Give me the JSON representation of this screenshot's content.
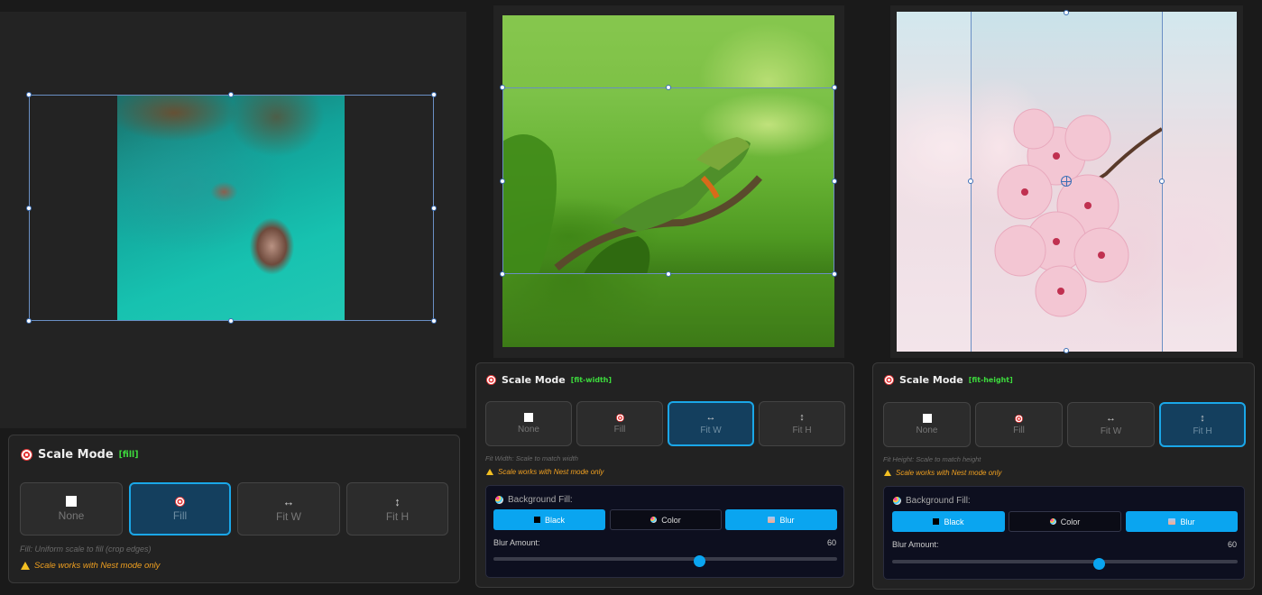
{
  "panels": [
    {
      "title": "Scale Mode",
      "mode_tag": "[fill]",
      "buttons": [
        {
          "label": "None",
          "icon": "square-icon"
        },
        {
          "label": "Fill",
          "icon": "target-icon"
        },
        {
          "label": "Fit W",
          "icon": "horizontal-arrows-icon",
          "glyph": "↔"
        },
        {
          "label": "Fit H",
          "icon": "vertical-arrows-icon",
          "glyph": "↕"
        }
      ],
      "active": "Fill",
      "hint": "Fill: Uniform scale to fill (crop edges)",
      "warning": "Scale works with Nest mode only"
    },
    {
      "title": "Scale Mode",
      "mode_tag": "[fit-width]",
      "buttons": [
        {
          "label": "None",
          "icon": "square-icon"
        },
        {
          "label": "Fill",
          "icon": "target-icon"
        },
        {
          "label": "Fit W",
          "icon": "horizontal-arrows-icon",
          "glyph": "↔"
        },
        {
          "label": "Fit H",
          "icon": "vertical-arrows-icon",
          "glyph": "↕"
        }
      ],
      "active": "Fit W",
      "hint": "Fit Width: Scale to match width",
      "warning": "Scale works with Nest mode only",
      "background_fill": {
        "label": "Background Fill:",
        "options": [
          "Black",
          "Color",
          "Blur"
        ],
        "highlighted": [
          "Black",
          "Blur"
        ],
        "blur_label": "Blur Amount:",
        "blur_value": "60",
        "blur_fraction": 0.6
      }
    },
    {
      "title": "Scale Mode",
      "mode_tag": "[fit-height]",
      "buttons": [
        {
          "label": "None",
          "icon": "square-icon"
        },
        {
          "label": "Fill",
          "icon": "target-icon"
        },
        {
          "label": "Fit W",
          "icon": "horizontal-arrows-icon",
          "glyph": "↔"
        },
        {
          "label": "Fit H",
          "icon": "vertical-arrows-icon",
          "glyph": "↕"
        }
      ],
      "active": "Fit H",
      "hint": "Fit Height: Scale to match height",
      "warning": "Scale works with Nest mode only",
      "background_fill": {
        "label": "Background Fill:",
        "options": [
          "Black",
          "Color",
          "Blur"
        ],
        "highlighted": [
          "Black",
          "Blur"
        ],
        "blur_label": "Blur Amount:",
        "blur_value": "60",
        "blur_fraction": 0.6
      }
    }
  ],
  "colors": {
    "accent": "#0aa5f0",
    "active_border": "#1aa7e8",
    "mode_tag": "#3ddc3d",
    "warning": "#f0a020"
  }
}
